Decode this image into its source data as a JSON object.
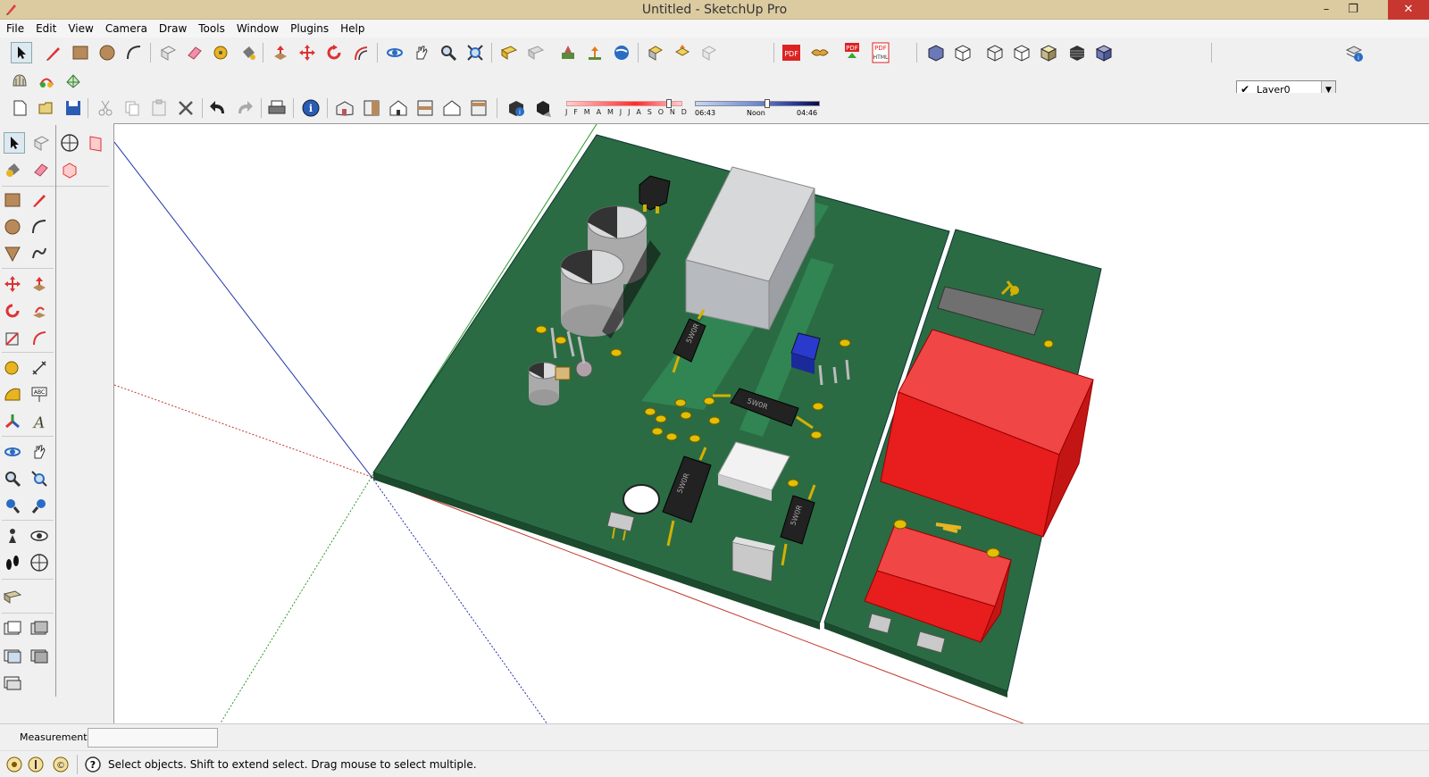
{
  "window": {
    "title": "Untitled - SketchUp Pro",
    "minimize": "–",
    "restore": "❐",
    "close": "✕"
  },
  "menu": [
    "File",
    "Edit",
    "View",
    "Camera",
    "Draw",
    "Tools",
    "Window",
    "Plugins",
    "Help"
  ],
  "layers": {
    "checkmark": "✔",
    "current": "Layer0"
  },
  "shadow_bar": {
    "months": [
      "J",
      "F",
      "M",
      "A",
      "M",
      "J",
      "J",
      "A",
      "S",
      "O",
      "N",
      "D"
    ],
    "time_start": "06:43",
    "time_mid": "Noon",
    "time_end": "04:46"
  },
  "toolbar_icons": {
    "pdf": "PDF",
    "html": "HTML",
    "abc": "ABC"
  },
  "component_labels": {
    "resistor_text": "5W0R"
  },
  "colors": {
    "pcb_green": "#2a6b43",
    "board_edge": "#1b4a2c",
    "relay_red": "#e81d1d",
    "transformer_gray": "#c0c3c7",
    "axis_red": "#c0392b",
    "axis_blue": "#2233aa",
    "titlebar": "#dccba0",
    "close_red": "#c7372f"
  },
  "status": {
    "measurements_label": "Measurements",
    "measurements_value": "",
    "hint": "Select objects. Shift to extend select. Drag mouse to select multiple."
  }
}
